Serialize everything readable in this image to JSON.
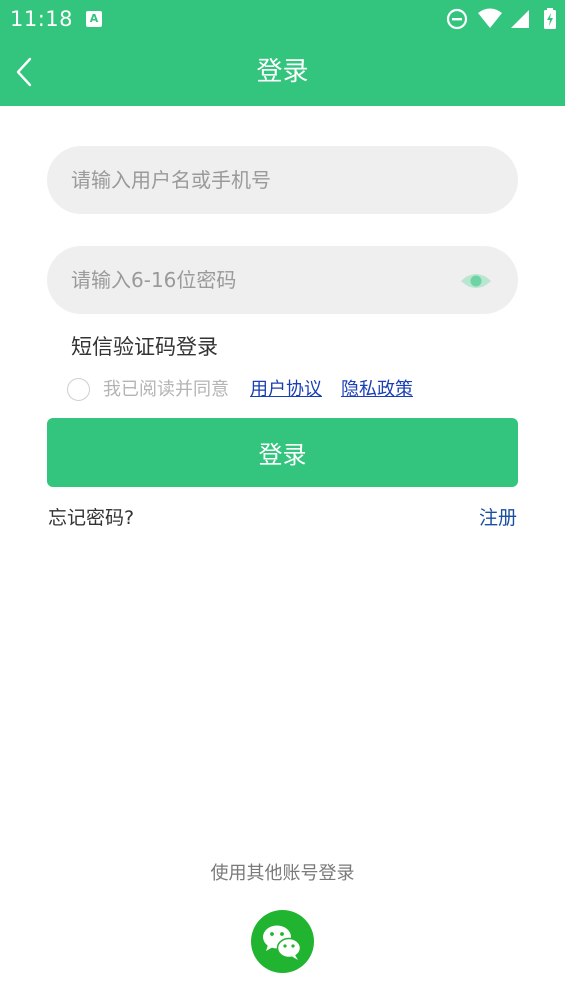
{
  "status_bar": {
    "time": "11:18",
    "notification_icon": "A"
  },
  "nav": {
    "title": "登录",
    "back_icon": "chevron-left-icon"
  },
  "form": {
    "username_placeholder": "请输入用户名或手机号",
    "password_placeholder": "请输入6-16位密码",
    "sms_login": "短信验证码登录",
    "agree_text": "我已阅读并同意",
    "user_agreement": "用户协议",
    "privacy_policy": "隐私政策",
    "login_button": "登录",
    "forgot_password": "忘记密码?",
    "register": "注册"
  },
  "other_login": {
    "label": "使用其他账号登录",
    "wechat_icon": "wechat-icon"
  },
  "colors": {
    "brand": "#33c47e",
    "link": "#1a3fb5",
    "wechat": "#21b430"
  }
}
